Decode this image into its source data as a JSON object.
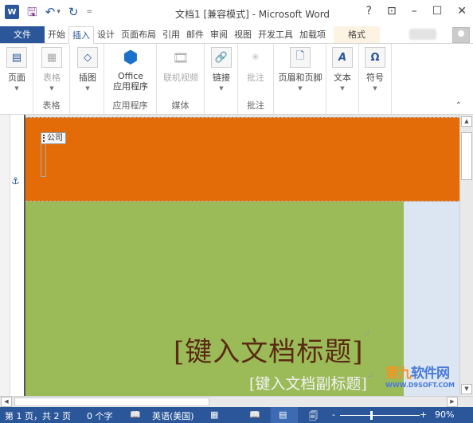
{
  "window": {
    "title": "文档1 [兼容模式] - Microsoft Word",
    "controls": {
      "help": "?",
      "ribbon_display": "⊡",
      "minimize": "–",
      "maximize": "☐",
      "close": "✕"
    }
  },
  "qat": {
    "logo": "W",
    "save": "🖫",
    "undo": "↶",
    "redo": "↻",
    "customize": "="
  },
  "tabs": [
    {
      "label": "文件"
    },
    {
      "label": "开始"
    },
    {
      "label": "插入"
    },
    {
      "label": "设计"
    },
    {
      "label": "页面布局"
    },
    {
      "label": "引用"
    },
    {
      "label": "邮件"
    },
    {
      "label": "审阅"
    },
    {
      "label": "视图"
    },
    {
      "label": "开发工具"
    },
    {
      "label": "加载项"
    },
    {
      "label": "格式"
    }
  ],
  "active_tab": "插入",
  "ribbon": {
    "groups": [
      {
        "label": "",
        "buttons": [
          {
            "label": "页面",
            "icon": "page-icon",
            "enabled": true
          }
        ]
      },
      {
        "label": "表格",
        "buttons": [
          {
            "label": "表格",
            "icon": "table-icon",
            "enabled": false
          }
        ]
      },
      {
        "label": "",
        "buttons": [
          {
            "label": "插图",
            "icon": "illustrations-icon",
            "enabled": true
          }
        ]
      },
      {
        "label": "应用程序",
        "buttons": [
          {
            "label": "Office",
            "label2": "应用程序",
            "icon": "office-apps-icon",
            "enabled": true
          }
        ]
      },
      {
        "label": "媒体",
        "buttons": [
          {
            "label": "联机视频",
            "icon": "online-video-icon",
            "enabled": false
          }
        ]
      },
      {
        "label": "",
        "buttons": [
          {
            "label": "链接",
            "icon": "link-icon",
            "enabled": true
          }
        ]
      },
      {
        "label": "批注",
        "buttons": [
          {
            "label": "批注",
            "icon": "comment-icon",
            "enabled": false
          }
        ]
      },
      {
        "label": "",
        "buttons": [
          {
            "label": "页眉和页脚",
            "icon": "header-footer-icon",
            "enabled": true
          }
        ]
      },
      {
        "label": "",
        "buttons": [
          {
            "label": "文本",
            "icon": "text-icon",
            "enabled": true
          }
        ]
      },
      {
        "label": "",
        "buttons": [
          {
            "label": "符号",
            "icon": "symbol-icon",
            "enabled": true
          }
        ]
      }
    ]
  },
  "document": {
    "company_placeholder": "公司",
    "title_placeholder": "[键入文档标题]",
    "subtitle_placeholder": "[键入文档副标题]",
    "colors": {
      "header_band": "#e36c09",
      "body_band": "#9bbb59",
      "side_band": "#dce6f2",
      "title_text": "#5a2a12"
    }
  },
  "watermark": {
    "brand_prefix": "第九",
    "brand": "软件网",
    "url": "WWW.D9SOFT.COM"
  },
  "statusbar": {
    "page": "第 1 页，共 2 页",
    "words": "0 个字",
    "language": "英语(美国)",
    "zoom": "90%",
    "zoom_minus": "-",
    "zoom_plus": "+"
  }
}
